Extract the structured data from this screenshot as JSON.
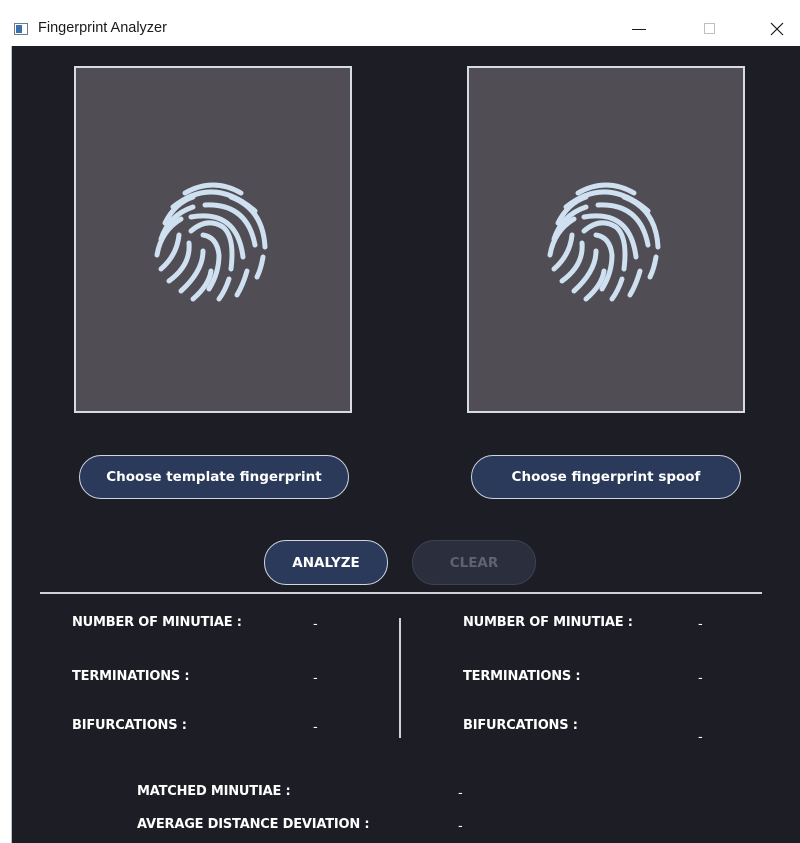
{
  "window": {
    "title": "Fingerprint Analyzer",
    "controls": {
      "minimize": "minimize",
      "maximize": "maximize",
      "close": "close"
    }
  },
  "fingerprints": {
    "left_icon": "fingerprint-icon",
    "right_icon": "fingerprint-icon"
  },
  "buttons": {
    "choose_template": "Choose template fingerprint",
    "choose_spoof": "Choose fingerprint spoof",
    "analyze": "ANALYZE",
    "clear": "CLEAR"
  },
  "left_stats": {
    "minutiae_label": "NUMBER OF MINUTIAE :",
    "minutiae_value": "-",
    "terminations_label": "TERMINATIONS :",
    "terminations_value": "-",
    "bifurcations_label": "BIFURCATIONS :",
    "bifurcations_value": "-"
  },
  "right_stats": {
    "minutiae_label": "NUMBER OF MINUTIAE :",
    "minutiae_value": "-",
    "terminations_label": "TERMINATIONS :",
    "terminations_value": "-",
    "bifurcations_label": "BIFURCATIONS :",
    "bifurcations_value": "-"
  },
  "summary": {
    "matched_label": "MATCHED MINUTIAE :",
    "matched_value": "-",
    "deviation_label": "AVERAGE DISTANCE DEVIATION :",
    "deviation_value": "-"
  }
}
